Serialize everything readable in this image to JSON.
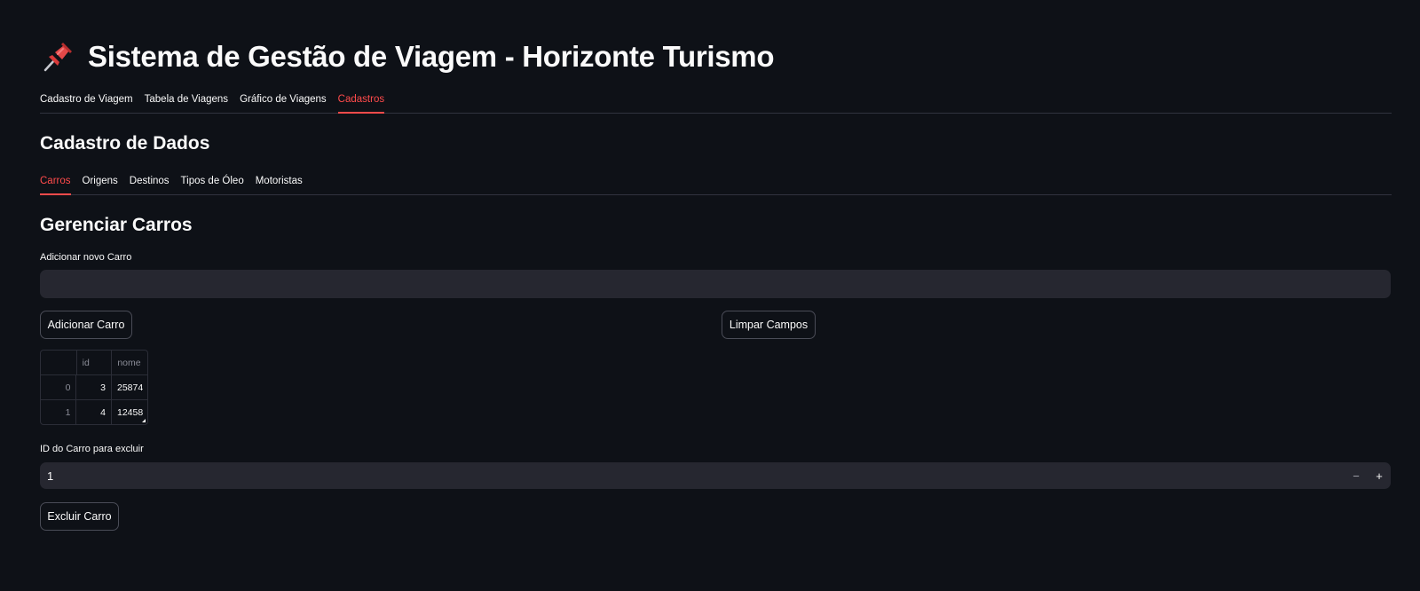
{
  "header": {
    "title": "Sistema de Gestão de Viagem - Horizonte Turismo",
    "icon": "pushpin-icon"
  },
  "main_tabs": [
    {
      "label": "Cadastro de Viagem",
      "active": false
    },
    {
      "label": "Tabela de Viagens",
      "active": false
    },
    {
      "label": "Gráfico de Viagens",
      "active": false
    },
    {
      "label": "Cadastros",
      "active": true
    }
  ],
  "subheader": "Cadastro de Dados",
  "sub_tabs": [
    {
      "label": "Carros",
      "active": true
    },
    {
      "label": "Origens",
      "active": false
    },
    {
      "label": "Destinos",
      "active": false
    },
    {
      "label": "Tipos de Óleo",
      "active": false
    },
    {
      "label": "Motoristas",
      "active": false
    }
  ],
  "section": {
    "title": "Gerenciar Carros",
    "add_label": "Adicionar novo Carro",
    "add_value": "",
    "add_button": "Adicionar Carro",
    "clear_button": "Limpar Campos",
    "table": {
      "columns": [
        "",
        "id",
        "nome"
      ],
      "rows": [
        [
          "0",
          "3",
          "25874"
        ],
        [
          "1",
          "4",
          "12458"
        ]
      ]
    },
    "delete_label": "ID do Carro para excluir",
    "delete_value": "1",
    "stepper_minus": "−",
    "stepper_plus": "+",
    "delete_button": "Excluir Carro"
  },
  "colors": {
    "background": "#0e1117",
    "accent": "#ff4b4b",
    "input_bg": "#262730"
  }
}
